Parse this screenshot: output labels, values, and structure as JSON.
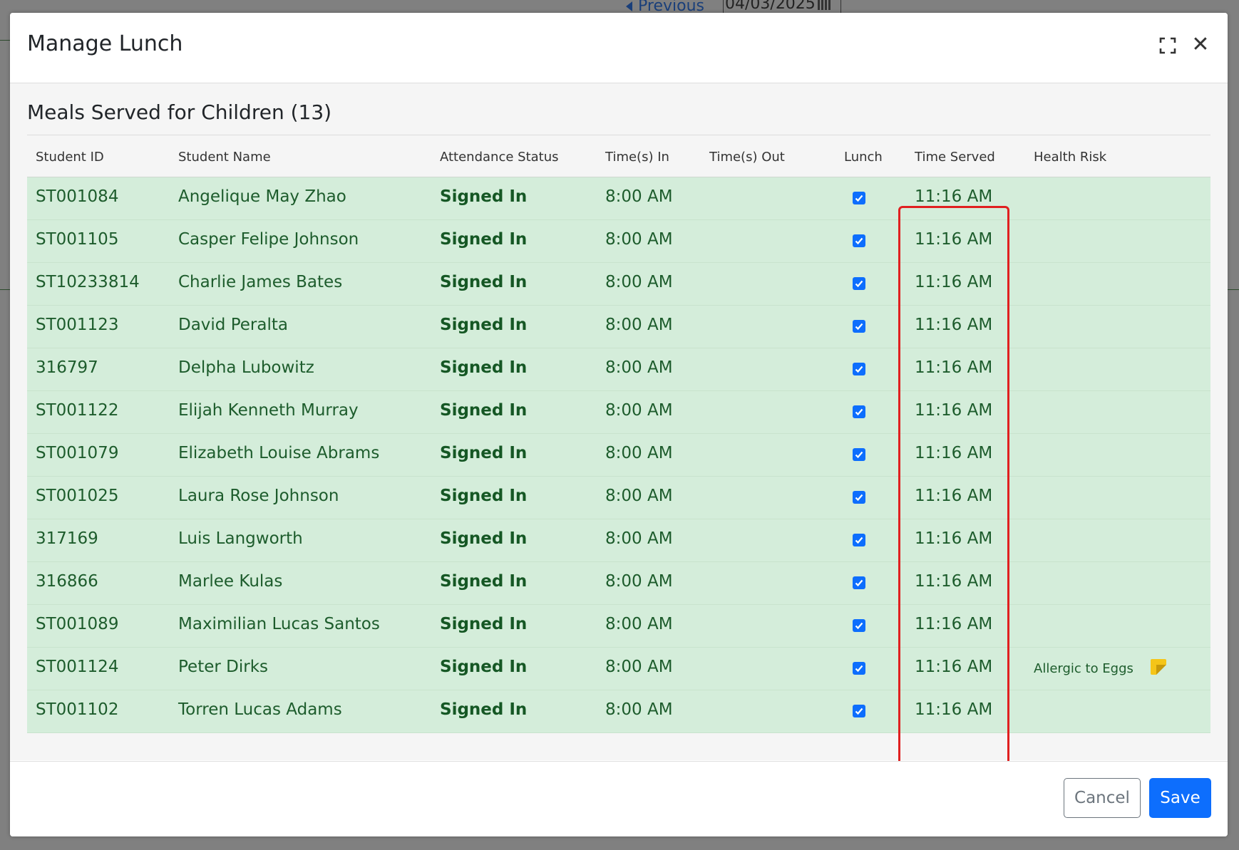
{
  "background": {
    "prev_label": "Previous",
    "date_value": "04/03/2025"
  },
  "modal": {
    "title": "Manage Lunch",
    "section_title": "Meals Served for Children (13)",
    "columns": [
      "Student ID",
      "Student Name",
      "Attendance Status",
      "Time(s) In",
      "Time(s) Out",
      "Lunch",
      "Time Served",
      "Health Risk"
    ],
    "rows": [
      {
        "id": "ST001084",
        "name": "Angelique May Zhao",
        "status": "Signed In",
        "time_in": "8:00 AM",
        "time_out": "",
        "lunch": true,
        "time_served": "11:16 AM",
        "health_risk": ""
      },
      {
        "id": "ST001105",
        "name": "Casper Felipe Johnson",
        "status": "Signed In",
        "time_in": "8:00 AM",
        "time_out": "",
        "lunch": true,
        "time_served": "11:16 AM",
        "health_risk": ""
      },
      {
        "id": "ST10233814",
        "name": "Charlie James Bates",
        "status": "Signed In",
        "time_in": "8:00 AM",
        "time_out": "",
        "lunch": true,
        "time_served": "11:16 AM",
        "health_risk": ""
      },
      {
        "id": "ST001123",
        "name": "David Peralta",
        "status": "Signed In",
        "time_in": "8:00 AM",
        "time_out": "",
        "lunch": true,
        "time_served": "11:16 AM",
        "health_risk": ""
      },
      {
        "id": "316797",
        "name": "Delpha Lubowitz",
        "status": "Signed In",
        "time_in": "8:00 AM",
        "time_out": "",
        "lunch": true,
        "time_served": "11:16 AM",
        "health_risk": ""
      },
      {
        "id": "ST001122",
        "name": "Elijah Kenneth Murray",
        "status": "Signed In",
        "time_in": "8:00 AM",
        "time_out": "",
        "lunch": true,
        "time_served": "11:16 AM",
        "health_risk": ""
      },
      {
        "id": "ST001079",
        "name": "Elizabeth Louise Abrams",
        "status": "Signed In",
        "time_in": "8:00 AM",
        "time_out": "",
        "lunch": true,
        "time_served": "11:16 AM",
        "health_risk": ""
      },
      {
        "id": "ST001025",
        "name": "Laura Rose Johnson",
        "status": "Signed In",
        "time_in": "8:00 AM",
        "time_out": "",
        "lunch": true,
        "time_served": "11:16 AM",
        "health_risk": ""
      },
      {
        "id": "317169",
        "name": "Luis Langworth",
        "status": "Signed In",
        "time_in": "8:00 AM",
        "time_out": "",
        "lunch": true,
        "time_served": "11:16 AM",
        "health_risk": ""
      },
      {
        "id": "316866",
        "name": "Marlee Kulas",
        "status": "Signed In",
        "time_in": "8:00 AM",
        "time_out": "",
        "lunch": true,
        "time_served": "11:16 AM",
        "health_risk": ""
      },
      {
        "id": "ST001089",
        "name": "Maximilian Lucas Santos",
        "status": "Signed In",
        "time_in": "8:00 AM",
        "time_out": "",
        "lunch": true,
        "time_served": "11:16 AM",
        "health_risk": ""
      },
      {
        "id": "ST001124",
        "name": "Peter Dirks",
        "status": "Signed In",
        "time_in": "8:00 AM",
        "time_out": "",
        "lunch": true,
        "time_served": "11:16 AM",
        "health_risk": "Allergic to Eggs",
        "has_note": true
      },
      {
        "id": "ST001102",
        "name": "Torren Lucas Adams",
        "status": "Signed In",
        "time_in": "8:00 AM",
        "time_out": "",
        "lunch": true,
        "time_served": "11:16 AM",
        "health_risk": ""
      }
    ],
    "cancel_label": "Cancel",
    "save_label": "Save"
  },
  "colors": {
    "row_bg": "#d4edda",
    "status_text": "#155724",
    "primary": "#0d6efd",
    "highlight": "#e02020"
  }
}
